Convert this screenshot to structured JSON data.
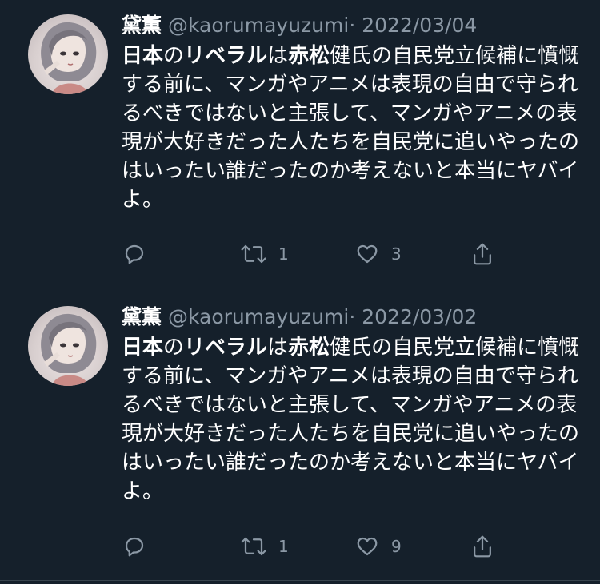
{
  "tweets": [
    {
      "display_name": "黛薫",
      "handle": "@kaorumayuzumi",
      "separator": "·",
      "date": "2022/03/04",
      "text": {
        "b1": "日本",
        "t1": "の",
        "b2": "リベラル",
        "t2": "は",
        "b3": "赤松",
        "t3": "健氏の自民党立候補に憤慨する前に、マンガやアニメは表現の自由で守られるべきではないと主張して、マンガやアニメの表現が大好きだった人たちを自民党に追いやったのはいったい誰だったのか考えないと本当にヤバイよ。"
      },
      "retweets": "1",
      "likes": "3"
    },
    {
      "display_name": "黛薫",
      "handle": "@kaorumayuzumi",
      "separator": "·",
      "date": "2022/03/02",
      "text": {
        "b1": "日本",
        "t1": "の",
        "b2": "リベラル",
        "t2": "は",
        "b3": "赤松",
        "t3": "健氏の自民党立候補に憤慨する前に、マンガやアニメは表現の自由で守られるべきではないと主張して、マンガやアニメの表現が大好きだった人たちを自民党に追いやったのはいったい誰だったのか考えないと本当にヤバイよ。"
      },
      "retweets": "1",
      "likes": "9"
    }
  ]
}
